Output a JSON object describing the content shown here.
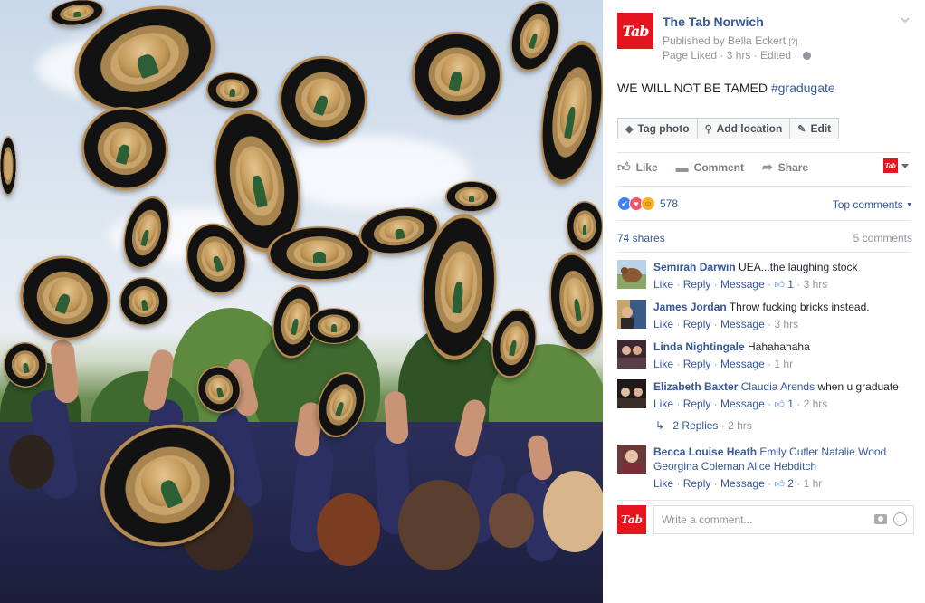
{
  "page": {
    "name": "The Tab Norwich",
    "logo_text": "Tab",
    "published_by": "Published by Bella Eckert",
    "published_help": "[?]",
    "meta": "Page Liked · 3 hrs · Edited ·"
  },
  "post": {
    "text": "WE WILL NOT BE TAMED",
    "hashtag": "#gradugate"
  },
  "buttons": {
    "tag_photo": "Tag photo",
    "add_location": "Add location",
    "edit": "Edit"
  },
  "ufi": {
    "like": "Like",
    "comment": "Comment",
    "share": "Share",
    "reaction_count": "578",
    "top_comments": "Top comments",
    "shares": "74 shares",
    "comments_count": "5 comments"
  },
  "comments": [
    {
      "author": "Semirah Darwin",
      "text": "UEA...the laughing stock",
      "like": "Like",
      "reply": "Reply",
      "message": "Message",
      "likes": "1",
      "time": "3 hrs"
    },
    {
      "author": "James Jordan",
      "text": "Throw fucking bricks instead.",
      "like": "Like",
      "reply": "Reply",
      "message": "Message",
      "time": "3 hrs"
    },
    {
      "author": "Linda Nightingale",
      "text": "Hahahahaha",
      "like": "Like",
      "reply": "Reply",
      "message": "Message",
      "time": "1 hr"
    },
    {
      "author": "Elizabeth Baxter",
      "mention": "Claudia Arends",
      "text": "when u graduate",
      "like": "Like",
      "reply": "Reply",
      "message": "Message",
      "likes": "1",
      "time": "2 hrs",
      "replies": "2 Replies",
      "replies_time": "2 hrs"
    },
    {
      "author": "Becca Louise Heath",
      "mentions": "Emily Cutler Natalie Wood Georgina Coleman Alice Hebditch",
      "like": "Like",
      "reply": "Reply",
      "message": "Message",
      "likes": "2",
      "time": "1 hr"
    }
  ],
  "composer": {
    "placeholder": "Write a comment..."
  },
  "colors": {
    "brand_red": "#e4151f",
    "link_blue": "#365899",
    "meta_gray": "#90949c"
  }
}
